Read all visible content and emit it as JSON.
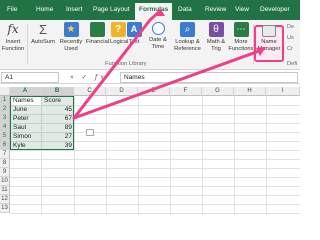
{
  "tabs": [
    {
      "label": "File"
    },
    {
      "label": "Home"
    },
    {
      "label": "Insert"
    },
    {
      "label": "Page Layout"
    },
    {
      "label": "Formulas"
    },
    {
      "label": "Data"
    },
    {
      "label": "Review"
    },
    {
      "label": "View"
    },
    {
      "label": "Developer"
    }
  ],
  "active_tab": "Formulas",
  "ribbon": {
    "buttons": [
      {
        "label": "Insert\nFunction",
        "icon": "fx-icon"
      },
      {
        "label": "AutoSum",
        "icon": "autosum-icon"
      },
      {
        "label": "Recently\nUsed",
        "icon": "star-icon"
      },
      {
        "label": "Financial",
        "icon": "book-icon"
      },
      {
        "label": "Logical",
        "icon": "question-icon"
      },
      {
        "label": "Text",
        "icon": "text-icon"
      },
      {
        "label": "Date &\nTime",
        "icon": "clock-icon"
      },
      {
        "label": "Lookup &\nReference",
        "icon": "search-icon"
      },
      {
        "label": "Math &\nTrig",
        "icon": "theta-icon"
      },
      {
        "label": "More\nFunctions",
        "icon": "functions-icon"
      },
      {
        "label": "Name\nManager",
        "icon": "tag-icon"
      }
    ],
    "group_label": "Function Library",
    "group_label_right": "Defi",
    "side_items": [
      "De",
      "Us",
      "Cr"
    ]
  },
  "formula_bar": {
    "name_box": "A1",
    "formula": "Names"
  },
  "columns": [
    "A",
    "B",
    "C",
    "D",
    "E",
    "F",
    "G",
    "H",
    "I"
  ],
  "rows": [
    "1",
    "2",
    "3",
    "4",
    "5",
    "6",
    "7",
    "8",
    "9",
    "10",
    "11",
    "12",
    "13"
  ],
  "table": {
    "headers": [
      "Names",
      "Score"
    ],
    "records": [
      {
        "name": "June",
        "score": "45"
      },
      {
        "name": "Peter",
        "score": "67"
      },
      {
        "name": "Saul",
        "score": "89"
      },
      {
        "name": "Simon",
        "score": "27"
      },
      {
        "name": "Kyle",
        "score": "39"
      }
    ]
  },
  "colors": {
    "excel_green": "#217346",
    "annotation_pink": "#ef3f86"
  }
}
